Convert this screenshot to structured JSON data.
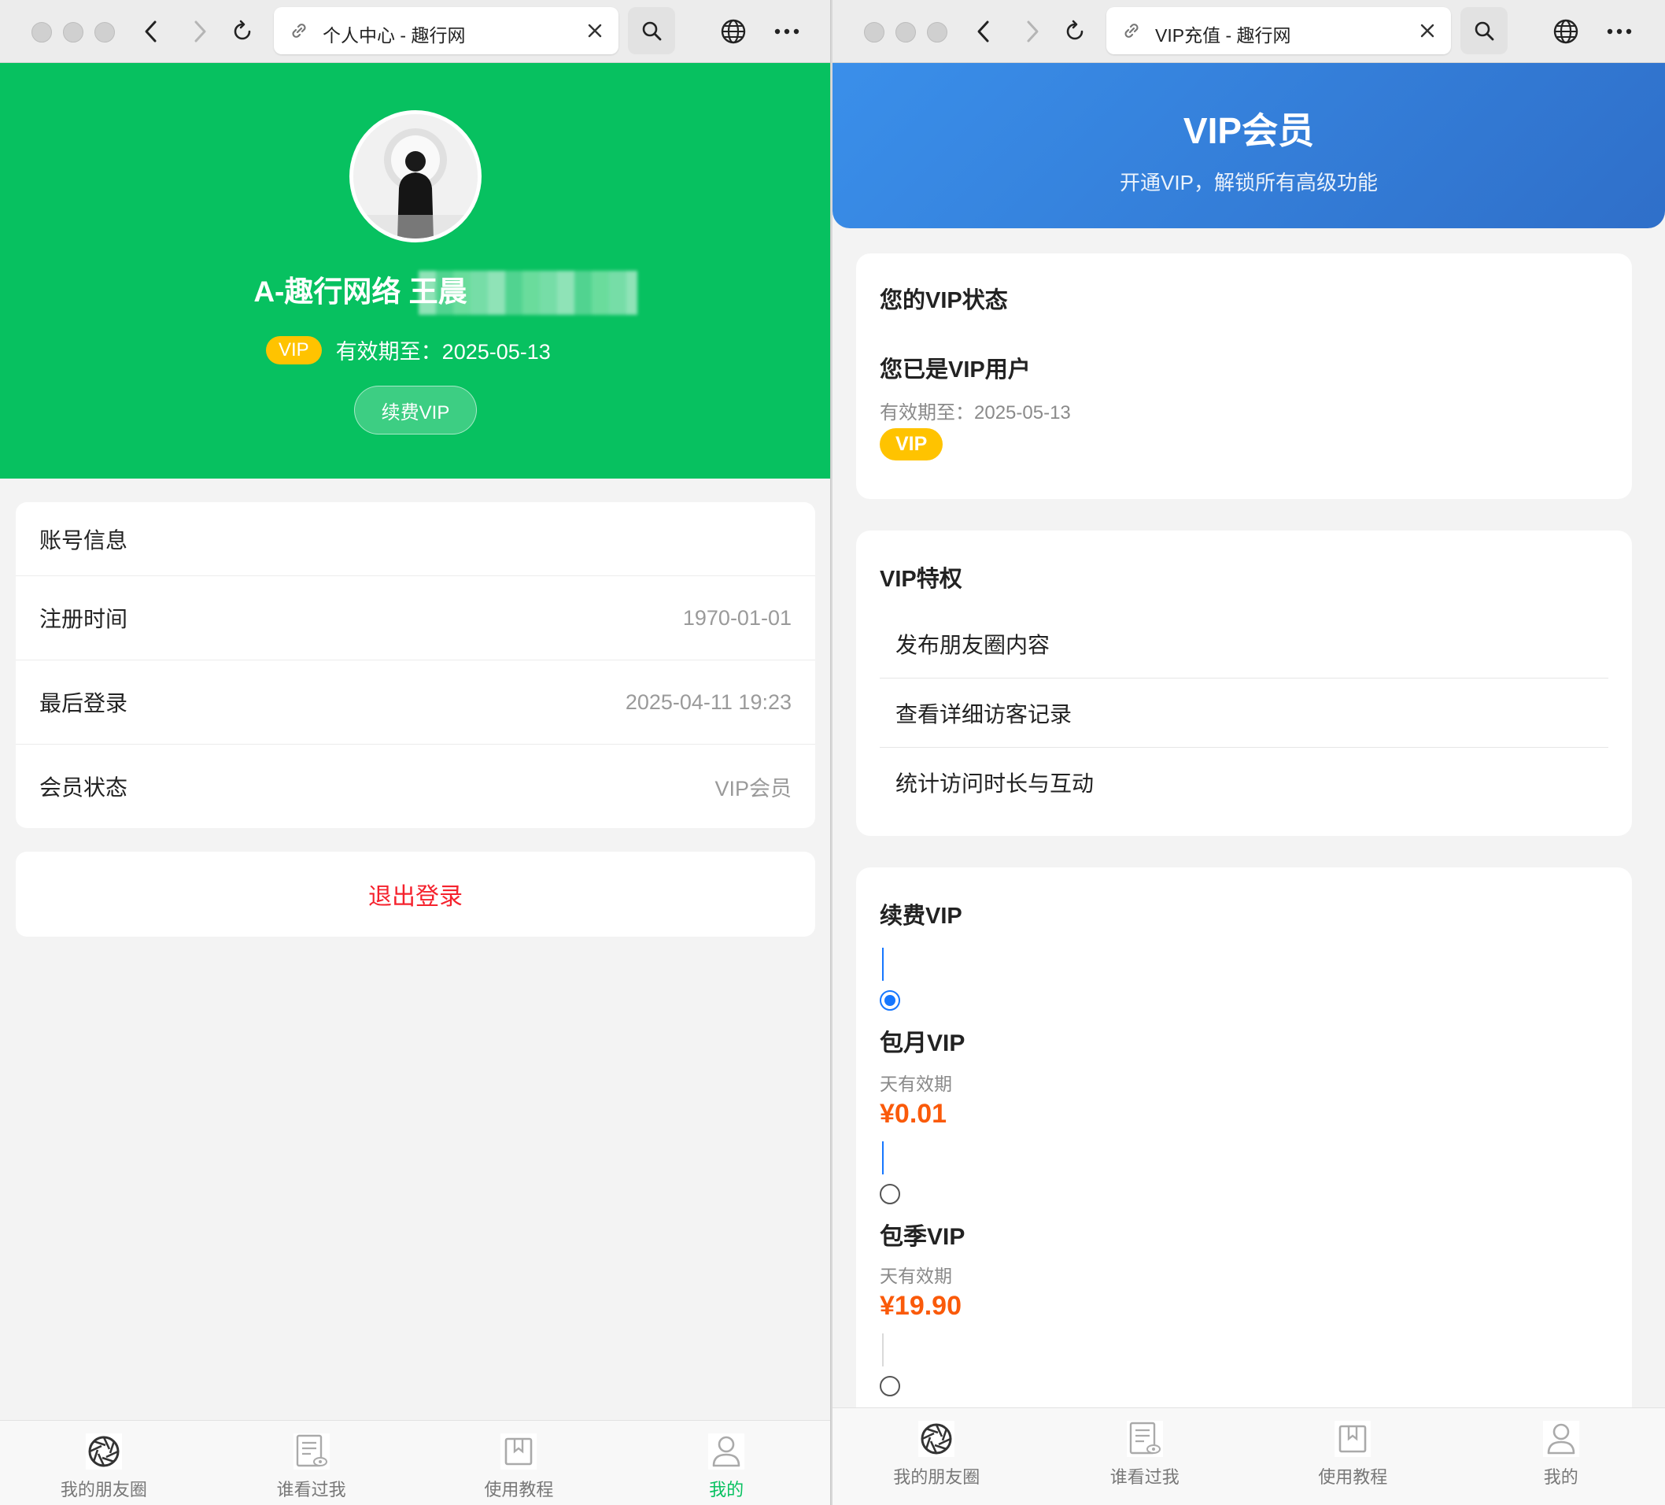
{
  "left_window": {
    "tab_title": "个人中心 - 趣行网",
    "profile": {
      "username": "A-趣行网络 王晨",
      "vip_badge": "VIP",
      "expire_text": "有效期至：2025-05-13",
      "renew_button": "续费VIP"
    },
    "account_info": {
      "header": "账号信息",
      "rows": [
        {
          "label": "注册时间",
          "value": "1970-01-01"
        },
        {
          "label": "最后登录",
          "value": "2025-04-11 19:23"
        },
        {
          "label": "会员状态",
          "value": "VIP会员"
        }
      ]
    },
    "logout_button": "退出登录",
    "tabbar": [
      {
        "label": "我的朋友圈",
        "icon": "aperture-icon",
        "active": false
      },
      {
        "label": "谁看过我",
        "icon": "document-eye-icon",
        "active": false
      },
      {
        "label": "使用教程",
        "icon": "bookmark-icon",
        "active": false
      },
      {
        "label": "我的",
        "icon": "user-icon",
        "active": true
      }
    ]
  },
  "right_window": {
    "tab_title": "VIP充值 - 趣行网",
    "hero": {
      "title": "VIP会员",
      "subtitle": "开通VIP，解锁所有高级功能"
    },
    "status_card": {
      "title": "您的VIP状态",
      "status": "您已是VIP用户",
      "expire": "有效期至：2025-05-13",
      "badge": "VIP"
    },
    "privileges_card": {
      "title": "VIP特权",
      "items": [
        "发布朋友圈内容",
        "查看详细访客记录",
        "统计访问时长与互动"
      ]
    },
    "renew_card": {
      "title": "续费VIP",
      "plans": [
        {
          "name": "包月VIP",
          "validity": "天有效期",
          "price": "¥0.01",
          "selected": true
        },
        {
          "name": "包季VIP",
          "validity": "天有效期",
          "price": "¥19.90",
          "selected": false
        }
      ]
    },
    "tabbar": [
      {
        "label": "我的朋友圈",
        "icon": "aperture-icon"
      },
      {
        "label": "谁看过我",
        "icon": "document-eye-icon"
      },
      {
        "label": "使用教程",
        "icon": "bookmark-icon"
      },
      {
        "label": "我的",
        "icon": "user-icon"
      }
    ]
  },
  "colors": {
    "brand_green": "#07c160",
    "vip_gold": "#ffc300",
    "vip_blue": "#3a8fea",
    "logout_red": "#f5222d",
    "price_orange": "#fa5a0a",
    "radio_blue": "#1677ff"
  }
}
